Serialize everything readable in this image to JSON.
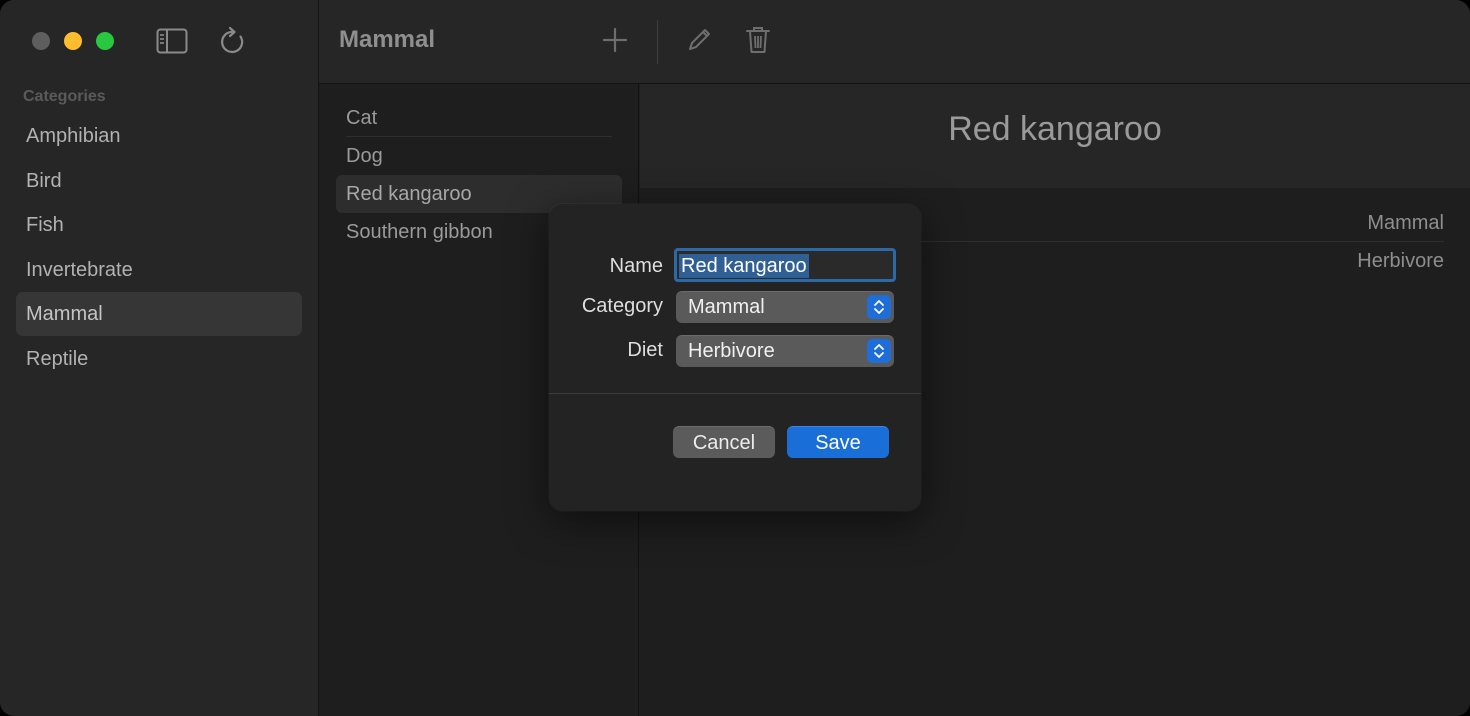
{
  "sidebar": {
    "section_title": "Categories",
    "items": [
      {
        "label": "Amphibian"
      },
      {
        "label": "Bird"
      },
      {
        "label": "Fish"
      },
      {
        "label": "Invertebrate"
      },
      {
        "label": "Mammal",
        "selected": true
      },
      {
        "label": "Reptile"
      }
    ],
    "icons": {
      "toggle": "sidebar-toggle-icon",
      "refresh": "refresh-icon"
    }
  },
  "toolbar": {
    "title": "Mammal",
    "icons": {
      "add": "plus-icon",
      "edit": "pencil-icon",
      "delete": "trash-icon"
    }
  },
  "list": {
    "items": [
      {
        "label": "Cat"
      },
      {
        "label": "Dog"
      },
      {
        "label": "Red kangaroo",
        "selected": true
      },
      {
        "label": "Southern gibbon"
      }
    ]
  },
  "detail": {
    "title": "Red kangaroo",
    "category": "Mammal",
    "diet": "Herbivore"
  },
  "dialog": {
    "name_label": "Name",
    "name_value": "Red kangaroo",
    "category_label": "Category",
    "category_value": "Mammal",
    "diet_label": "Diet",
    "diet_value": "Herbivore",
    "cancel_label": "Cancel",
    "save_label": "Save"
  },
  "colors": {
    "accent": "#1a6ed8",
    "close": "#5e5e5e",
    "minimize": "#febc2e",
    "maximize": "#28c840"
  }
}
